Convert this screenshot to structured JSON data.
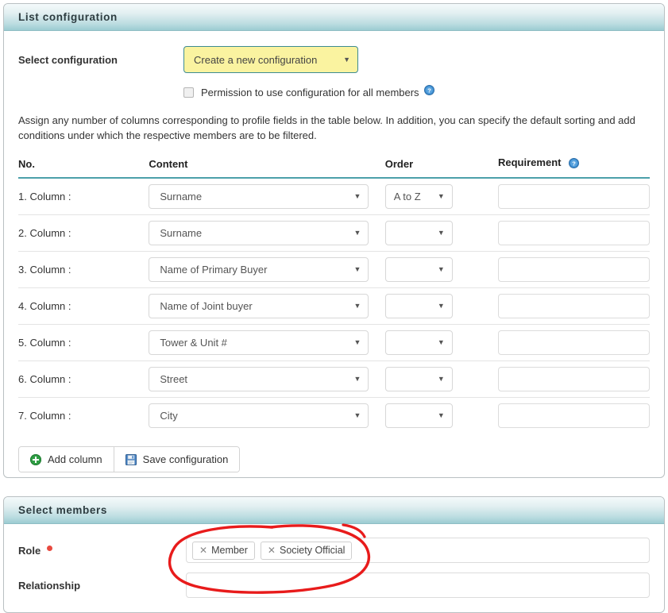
{
  "panels": {
    "list_configuration": {
      "title": "List configuration",
      "select_configuration_label": "Select configuration",
      "configuration_value": "Create a new configuration",
      "permission_checkbox_label": "Permission to use configuration for all members",
      "permission_help_icon": "help-icon",
      "intro_text": "Assign any number of columns corresponding to profile fields in the table below. In addition, you can specify the default sorting and add conditions under which the respective members are to be filtered.",
      "table": {
        "headers": {
          "no": "No.",
          "content": "Content",
          "order": "Order",
          "requirement": "Requirement",
          "requirement_help_icon": "help-icon"
        },
        "rows": [
          {
            "no": "1. Column :",
            "content": "Surname",
            "order": "A to Z",
            "requirement": ""
          },
          {
            "no": "2. Column :",
            "content": "Surname",
            "order": "",
            "requirement": ""
          },
          {
            "no": "3. Column :",
            "content": "Name of Primary Buyer",
            "order": "",
            "requirement": ""
          },
          {
            "no": "4. Column :",
            "content": "Name of Joint buyer",
            "order": "",
            "requirement": ""
          },
          {
            "no": "5. Column :",
            "content": "Tower & Unit #",
            "order": "",
            "requirement": ""
          },
          {
            "no": "6. Column :",
            "content": "Street",
            "order": "",
            "requirement": ""
          },
          {
            "no": "7. Column :",
            "content": "City",
            "order": "",
            "requirement": ""
          }
        ]
      },
      "buttons": {
        "add_column": "Add column",
        "add_column_icon": "plus-circle-icon",
        "save_configuration": "Save configuration",
        "save_configuration_icon": "floppy-disk-icon"
      }
    },
    "select_members": {
      "title": "Select members",
      "role_label": "Role",
      "role_required_marker": "required-dot",
      "role_chips": [
        "Member",
        "Society Official"
      ],
      "chip_remove_icon": "close-icon",
      "relationship_label": "Relationship",
      "relationship_value": ""
    }
  },
  "annotation": {
    "shape": "hand-drawn-ellipse",
    "color": "#e81b1b",
    "target": "role-field"
  },
  "colors": {
    "panel_header_top": "#f4fafb",
    "panel_header_bottom": "#9cccd2",
    "accent_rule": "#4ca0aa",
    "config_select_bg": "#faf3a0",
    "config_select_border": "#3d8b92",
    "required_dot": "#e8493f",
    "annotation_red": "#e81b1b",
    "add_icon_green": "#2f9e44"
  }
}
